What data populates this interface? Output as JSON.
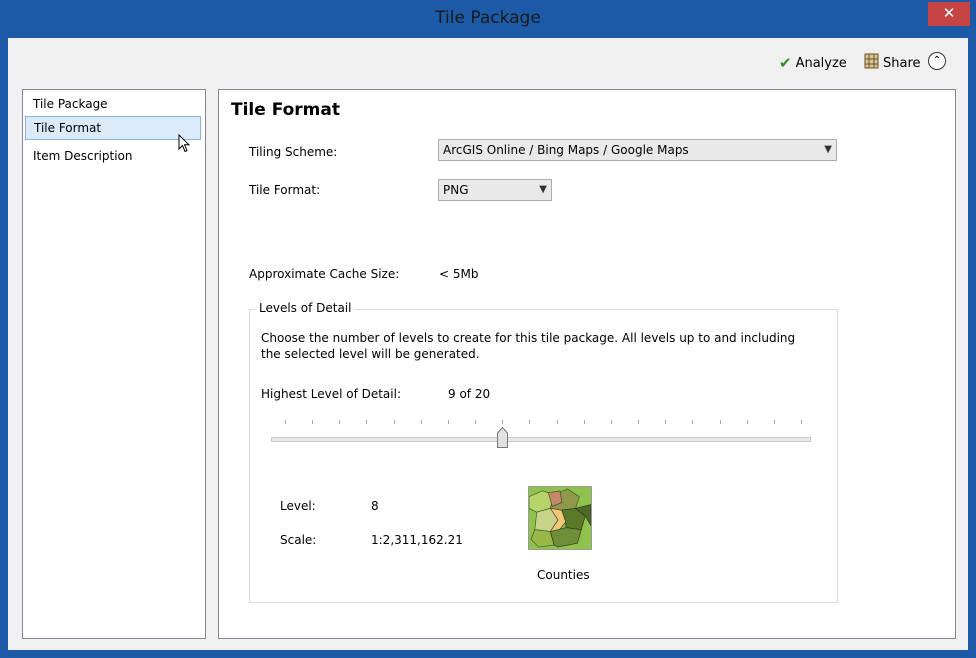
{
  "window": {
    "title": "Tile Package",
    "close_icon": "✕"
  },
  "toolbar": {
    "analyze_label": "Analyze",
    "share_label": "Share",
    "collapse_icon": "⌃"
  },
  "nav": {
    "items": [
      {
        "label": "Tile Package"
      },
      {
        "label": "Tile Format",
        "selected": true
      },
      {
        "label": "Item Description"
      }
    ]
  },
  "panel": {
    "title": "Tile Format",
    "tiling_scheme_label": "Tiling Scheme:",
    "tiling_scheme_value": "ArcGIS Online / Bing Maps / Google Maps",
    "tile_format_label": "Tile Format:",
    "tile_format_value": "PNG",
    "cache_size_label": "Approximate Cache Size:",
    "cache_size_value": "< 5Mb",
    "levels": {
      "legend": "Levels of Detail",
      "description_line1": "Choose the number of levels to create for this tile package.   All levels up to and including",
      "description_line2": "the selected level will be generated.",
      "highest_label": "Highest Level of Detail:",
      "highest_value": "9 of 20",
      "slider_value": 9,
      "slider_max": 20,
      "level_label": "Level:",
      "level_value": "8",
      "scale_label": "Scale:",
      "scale_value": "1:2,311,162.21",
      "map_caption": "Counties"
    }
  },
  "colors": {
    "title_bar": "#1c5aa8",
    "close": "#c74444",
    "selection": "#dbeaf8"
  }
}
